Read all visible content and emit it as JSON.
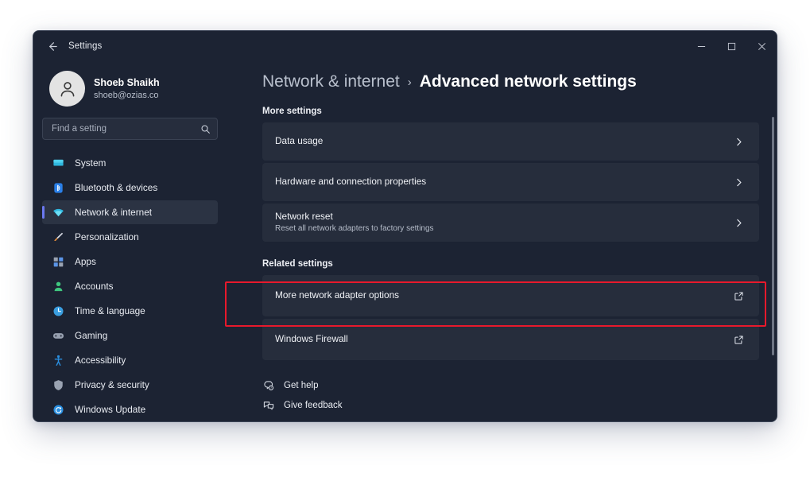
{
  "window": {
    "title": "Settings",
    "back_icon": "back-arrow-icon",
    "controls": {
      "minimize": "minimize-icon",
      "maximize": "maximize-icon",
      "close": "close-icon"
    }
  },
  "sidebar": {
    "profile": {
      "name": "Shoeb Shaikh",
      "email": "shoeb@ozias.co",
      "avatar_icon": "user-avatar-icon"
    },
    "search": {
      "placeholder": "Find a setting",
      "value": "",
      "icon": "search-icon"
    },
    "items": [
      {
        "label": "System",
        "icon": "monitor-icon",
        "color": "#2fb8e0",
        "selected": false
      },
      {
        "label": "Bluetooth & devices",
        "icon": "bluetooth-icon",
        "color": "#2a7fe8",
        "selected": false
      },
      {
        "label": "Network & internet",
        "icon": "wifi-icon",
        "color": "#2fb8e0",
        "selected": true
      },
      {
        "label": "Personalization",
        "icon": "paintbrush-icon",
        "color": "#e08a3c",
        "selected": false
      },
      {
        "label": "Apps",
        "icon": "apps-grid-icon",
        "color": "#5b95e8",
        "selected": false
      },
      {
        "label": "Accounts",
        "icon": "person-icon",
        "color": "#3fc77f",
        "selected": false
      },
      {
        "label": "Time & language",
        "icon": "clock-icon",
        "color": "#3a9ee0",
        "selected": false
      },
      {
        "label": "Gaming",
        "icon": "gamepad-icon",
        "color": "#97a0b0",
        "selected": false
      },
      {
        "label": "Accessibility",
        "icon": "accessibility-icon",
        "color": "#2a8fe0",
        "selected": false
      },
      {
        "label": "Privacy & security",
        "icon": "shield-icon",
        "color": "#9aa3b2",
        "selected": false
      },
      {
        "label": "Windows Update",
        "icon": "update-refresh-icon",
        "color": "#2a8fe0",
        "selected": false
      }
    ],
    "accent_color": "#6b79f0"
  },
  "main": {
    "breadcrumb": {
      "parent": "Network & internet",
      "separator": "›",
      "current": "Advanced network settings"
    },
    "more_settings": {
      "label": "More settings",
      "cards": [
        {
          "title": "Data usage",
          "subtitle": "",
          "icon": "chevron-right-icon"
        },
        {
          "title": "Hardware and connection properties",
          "subtitle": "",
          "icon": "chevron-right-icon"
        },
        {
          "title": "Network reset",
          "subtitle": "Reset all network adapters to factory settings",
          "icon": "chevron-right-icon"
        }
      ]
    },
    "related_settings": {
      "label": "Related settings",
      "cards": [
        {
          "title": "More network adapter options",
          "subtitle": "",
          "icon": "external-link-icon",
          "highlighted": true
        },
        {
          "title": "Windows Firewall",
          "subtitle": "",
          "icon": "external-link-icon",
          "highlighted": false
        }
      ]
    },
    "footer": [
      {
        "label": "Get help",
        "icon": "help-question-icon"
      },
      {
        "label": "Give feedback",
        "icon": "feedback-icon"
      }
    ],
    "highlight_color": "#e8192c"
  }
}
